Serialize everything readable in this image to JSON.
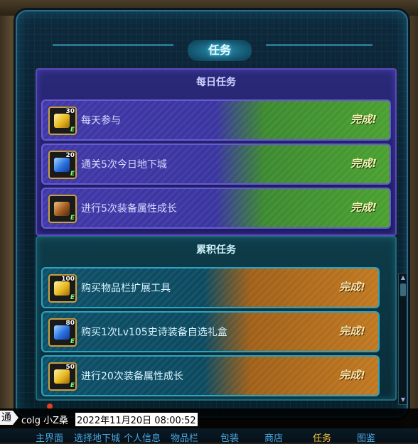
{
  "title": "任务",
  "daily": {
    "title": "每日任务",
    "quests": [
      {
        "count": "30",
        "icon": "gold-ticket-icon",
        "name": "每天参与",
        "status": "完成!"
      },
      {
        "count": "20",
        "icon": "blue-crystal-icon",
        "name": "通关5次今日地下城",
        "status": "完成!"
      },
      {
        "count": "",
        "icon": "equipment-growth-icon",
        "name": "进行5次装备属性成长",
        "status": "完成!"
      }
    ]
  },
  "cumulative": {
    "title": "累积任务",
    "quests": [
      {
        "count": "100",
        "icon": "gold-ticket-icon",
        "name": "购买物品栏扩展工具",
        "status": "完成!"
      },
      {
        "count": "80",
        "icon": "blue-crystal-icon",
        "name": "购买1次Lv105史诗装备自选礼盒",
        "status": "完成!"
      },
      {
        "count": "50",
        "icon": "gold-ticket-icon",
        "name": "进行20次装备属性成长",
        "status": "完成!"
      }
    ]
  },
  "badge_letter": "E",
  "chat": {
    "channel": "通",
    "text": "colg 小Z桑",
    "timestamp": "2022年11月20日 08:00:52"
  },
  "nav": [
    {
      "label": "主界面"
    },
    {
      "label": "选择地下城"
    },
    {
      "label": "个人信息"
    },
    {
      "label": "物品栏"
    },
    {
      "label": "包装"
    },
    {
      "label": "商店"
    },
    {
      "label": "任务"
    },
    {
      "label": "图鉴"
    }
  ],
  "colors": {
    "daily_complete": "#4aa030",
    "cumulative_complete": "#c07820",
    "active_nav": "#f0c040"
  }
}
